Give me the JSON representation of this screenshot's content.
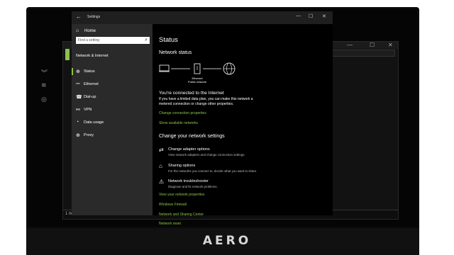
{
  "brand": "AERO",
  "background_window": {
    "footer_text": "1 ite"
  },
  "settings": {
    "title": "Settings",
    "window_controls": [
      "—",
      "☐",
      "✕"
    ],
    "nav": {
      "home_label": "Home",
      "search_placeholder": "Find a setting",
      "section_title": "Network & Internet",
      "items": [
        {
          "label": "Status",
          "icon": "globe-icon",
          "selected": true
        },
        {
          "label": "Ethernet",
          "icon": "ethernet-icon",
          "selected": false
        },
        {
          "label": "Dial-up",
          "icon": "dialup-icon",
          "selected": false
        },
        {
          "label": "VPN",
          "icon": "vpn-icon",
          "selected": false
        },
        {
          "label": "Data usage",
          "icon": "data-usage-icon",
          "selected": false
        },
        {
          "label": "Proxy",
          "icon": "proxy-icon",
          "selected": false
        }
      ]
    },
    "content": {
      "page_title": "Status",
      "network_status_heading": "Network status",
      "diagram_label_line1": "Ethernet",
      "diagram_label_line2": "Public network",
      "connected_heading": "You're connected to the Internet",
      "connected_desc_line1": "If you have a limited data plan, you can make this network a",
      "connected_desc_line2": "metered connection or change other properties.",
      "link_change_connection": "Change connection properties",
      "link_show_networks": "Show available networks",
      "change_settings_heading": "Change your network settings",
      "options": [
        {
          "title": "Change adapter options",
          "desc": "View network adapters and change connection settings."
        },
        {
          "title": "Sharing options",
          "desc": "For the networks you connect to, decide what you want to share."
        },
        {
          "title": "Network troubleshooter",
          "desc": "Diagnose and fix network problems."
        }
      ],
      "link_view_properties": "View your network properties",
      "link_firewall": "Windows Firewall",
      "link_sharing_center": "Network and Sharing Center",
      "link_network_reset": "Network reset"
    }
  },
  "colors": {
    "accent": "#8bc34a",
    "nav_bg": "#2a2a2a",
    "content_bg": "#000000"
  }
}
